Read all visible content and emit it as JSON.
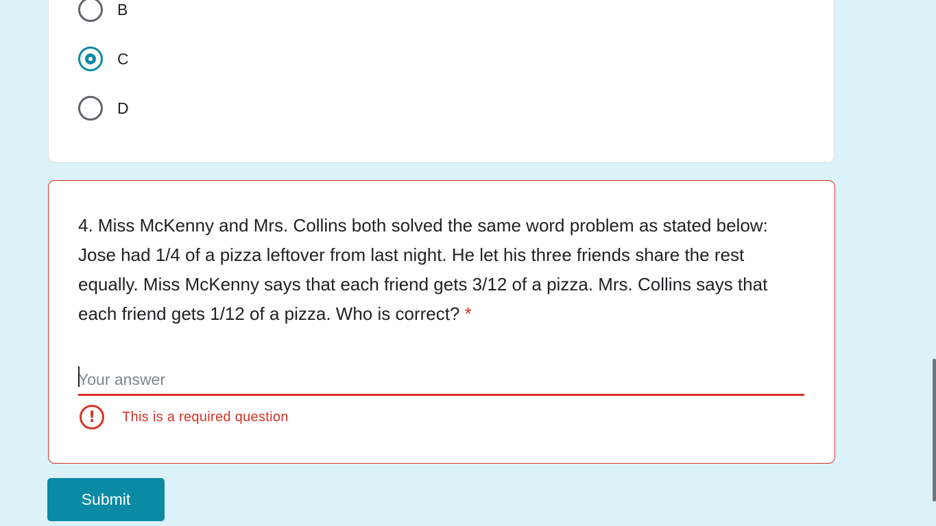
{
  "question3": {
    "options": [
      {
        "label": "B",
        "selected": false
      },
      {
        "label": "C",
        "selected": true
      },
      {
        "label": "D",
        "selected": false
      }
    ]
  },
  "question4": {
    "text": "4. Miss McKenny and Mrs. Collins both solved the same word problem as stated below: Jose had 1/4 of a pizza leftover from last night. He let his three friends share the rest equally. Miss McKenny says that each friend gets 3/12 of a pizza. Mrs. Collins says that each friend gets 1/12 of a pizza. Who is correct?",
    "required_marker": "*",
    "answer_placeholder": "Your answer",
    "answer_value": "",
    "error_message": "This is a required question",
    "error_icon": "!"
  },
  "submit_label": "Submit",
  "colors": {
    "background": "#dbf2f8",
    "accent": "#0b8aa6",
    "error": "#d93025"
  }
}
